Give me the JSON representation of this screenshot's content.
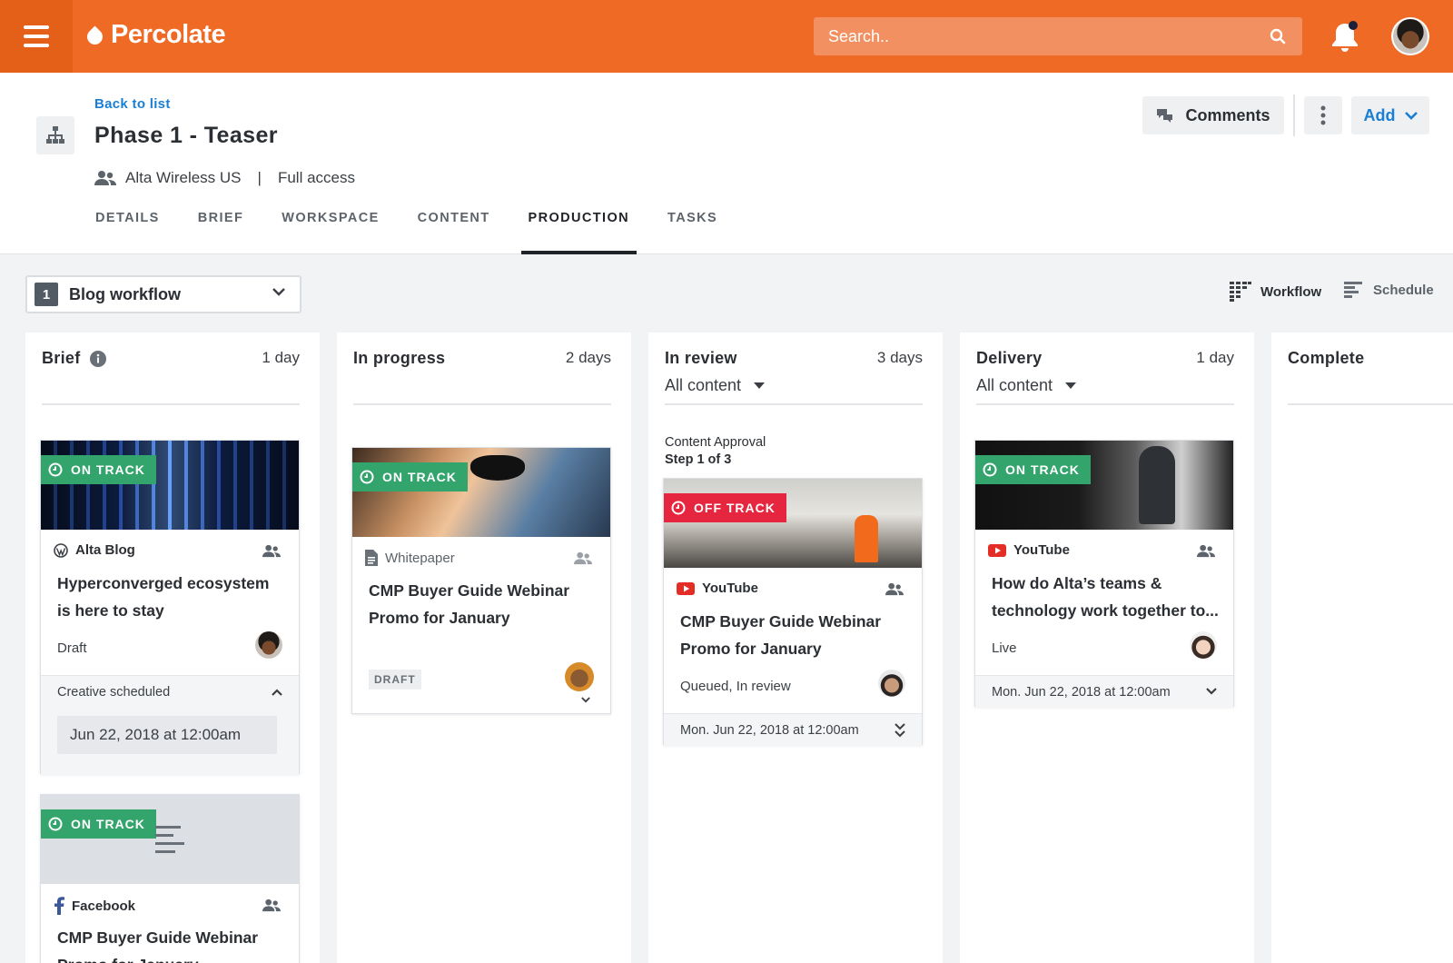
{
  "app": {
    "name": "Percolate"
  },
  "topbar": {
    "search_placeholder": "Search.."
  },
  "header": {
    "back_link": "Back to list",
    "title": "Phase 1 - Teaser",
    "owner": "Alta Wireless US",
    "access": "Full access",
    "comments_label": "Comments",
    "add_label": "Add",
    "tabs": [
      {
        "label": "DETAILS"
      },
      {
        "label": "BRIEF"
      },
      {
        "label": "WORKSPACE"
      },
      {
        "label": "CONTENT"
      },
      {
        "label": "PRODUCTION",
        "active": true
      },
      {
        "label": "TASKS"
      }
    ]
  },
  "toolbar": {
    "workflow_number": "1",
    "workflow_label": "Blog workflow",
    "view_workflow": "Workflow",
    "view_schedule": "Schedule"
  },
  "columns": [
    {
      "title": "Brief",
      "days": "1 day",
      "cards": [
        {
          "badge": "ON TRACK",
          "channel": "Alta Blog",
          "title": "Hyperconverged ecosystem is here to stay",
          "status": "Draft",
          "footer_label": "Creative scheduled",
          "date": "Jun 22, 2018 at 12:00am"
        },
        {
          "badge": "ON TRACK",
          "channel": "Facebook",
          "title": "CMP Buyer Guide Webinar Promo for January"
        }
      ]
    },
    {
      "title": "In progress",
      "days": "2 days",
      "cards": [
        {
          "badge": "ON TRACK",
          "channel": "Whitepaper",
          "title": "CMP Buyer Guide Webinar Promo for January",
          "status": "DRAFT"
        }
      ]
    },
    {
      "title": "In review",
      "days": "3 days",
      "filter": "All content",
      "approval": {
        "label": "Content Approval",
        "step": "Step 1 of 3"
      },
      "cards": [
        {
          "badge": "OFF TRACK",
          "channel": "YouTube",
          "title": "CMP Buyer Guide Webinar Promo for January",
          "status": "Queued, In review",
          "date": "Mon. Jun 22, 2018 at 12:00am"
        }
      ]
    },
    {
      "title": "Delivery",
      "days": "1 day",
      "filter": "All content",
      "cards": [
        {
          "badge": "ON TRACK",
          "channel": "YouTube",
          "title": "How do Alta’s teams & technology work together to...",
          "status": "Live",
          "date": "Mon. Jun 22, 2018 at 12:00am"
        }
      ]
    },
    {
      "title": "Complete"
    }
  ],
  "colors": {
    "brand_orange": "#ef6a24",
    "link_blue": "#1a7fd4",
    "on_track": "#34a46d",
    "off_track": "#e6263f",
    "youtube_red": "#e52d27"
  }
}
